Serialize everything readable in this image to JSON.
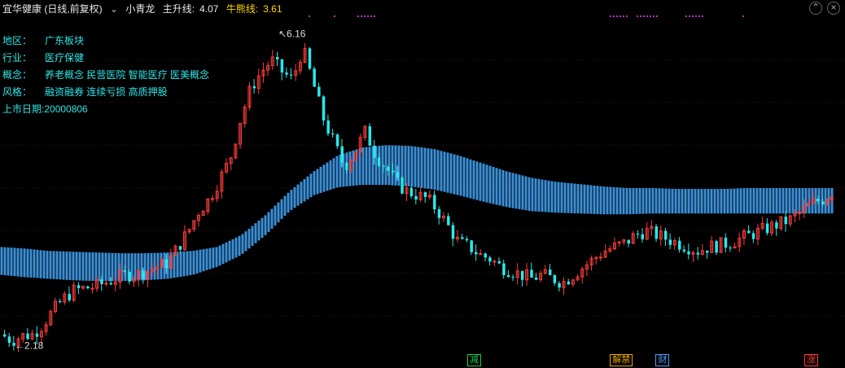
{
  "header": {
    "title": "宜华健康 (日线,前复权)",
    "indicator_name": "小青龙",
    "main_line_label": "主升线:",
    "main_line_value": "4.07",
    "bull_line_label": "牛熊线:",
    "bull_line_value": "3.61",
    "colors": {
      "main": "#e8e8e8",
      "bull": "#ffd400"
    }
  },
  "info": [
    {
      "key": "地区：",
      "value": "广东板块"
    },
    {
      "key": "行业：",
      "value": "医疗保健"
    },
    {
      "key": "概念：",
      "value": "养老概念 民营医院 智能医疗 医美概念"
    },
    {
      "key": "风格：",
      "value": "融资融券 连续亏损 高质押股"
    },
    {
      "key": "上市日期:",
      "value": "20000806"
    }
  ],
  "chart_data": {
    "type": "candlestick",
    "price_range": [
      2.0,
      6.3
    ],
    "grid": "horizontal dotted",
    "annotations": [
      {
        "label": "6.16",
        "type": "max"
      },
      {
        "label": "2.18",
        "type": "min"
      }
    ],
    "band": {
      "name": "小青龙",
      "color": "#3a8fd8",
      "upper": [
        3.4,
        3.38,
        3.35,
        3.34,
        3.33,
        3.32,
        3.32,
        3.33,
        3.35,
        3.4,
        3.55,
        3.8,
        4.1,
        4.35,
        4.55,
        4.65,
        4.68,
        4.67,
        4.63,
        4.55,
        4.45,
        4.35,
        4.27,
        4.22,
        4.19,
        4.16,
        4.14,
        4.14,
        4.13,
        4.13,
        4.13,
        4.14,
        4.14,
        4.14,
        4.14,
        4.14
      ],
      "lower": [
        3.05,
        3.02,
        3.0,
        2.98,
        2.97,
        2.97,
        2.98,
        3.0,
        3.05,
        3.15,
        3.3,
        3.55,
        3.85,
        4.05,
        4.15,
        4.18,
        4.18,
        4.16,
        4.12,
        4.05,
        3.97,
        3.9,
        3.85,
        3.83,
        3.82,
        3.81,
        3.81,
        3.82,
        3.82,
        3.82,
        3.82,
        3.82,
        3.82,
        3.82,
        3.82,
        3.82
      ]
    },
    "candles": {
      "up_color": "#ff3b3b",
      "down_color": "#2ae8e8",
      "close_path": [
        2.3,
        2.22,
        2.28,
        2.3,
        2.42,
        2.6,
        2.75,
        2.85,
        2.88,
        2.9,
        2.95,
        3.0,
        3.05,
        3.05,
        3.1,
        3.15,
        3.2,
        3.4,
        3.6,
        3.85,
        4.0,
        4.25,
        4.5,
        5.0,
        5.4,
        5.6,
        5.75,
        5.6,
        5.5,
        5.9,
        5.45,
        5.0,
        4.7,
        4.4,
        4.6,
        4.85,
        4.55,
        4.4,
        4.2,
        4.1,
        4.05,
        4.0,
        3.85,
        3.65,
        3.45,
        3.4,
        3.3,
        3.25,
        3.15,
        3.1,
        3.05,
        3.0,
        3.05,
        3.0,
        2.95,
        3.05,
        3.15,
        3.25,
        3.35,
        3.4,
        3.45,
        3.55,
        3.6,
        3.55,
        3.5,
        3.45,
        3.4,
        3.35,
        3.4,
        3.42,
        3.45,
        3.5,
        3.55,
        3.6,
        3.65,
        3.7,
        3.75,
        3.85,
        3.95,
        4.0,
        4.1
      ]
    },
    "series": [
      {
        "name": "主升线",
        "last": 4.07
      },
      {
        "name": "牛熊线",
        "last": 3.61
      }
    ]
  },
  "markers": [
    {
      "label": "减",
      "color": "#1ecb4a",
      "pos": 0.553
    },
    {
      "label": "解禁",
      "color": "#e6a400",
      "pos": 0.722
    },
    {
      "label": "财",
      "color": "#4a9cff",
      "pos": 0.776
    },
    {
      "label": "涨",
      "color": "#ff3b3b",
      "pos": 0.952
    }
  ],
  "window_icons": [
    "settings-icon",
    "close-icon"
  ]
}
